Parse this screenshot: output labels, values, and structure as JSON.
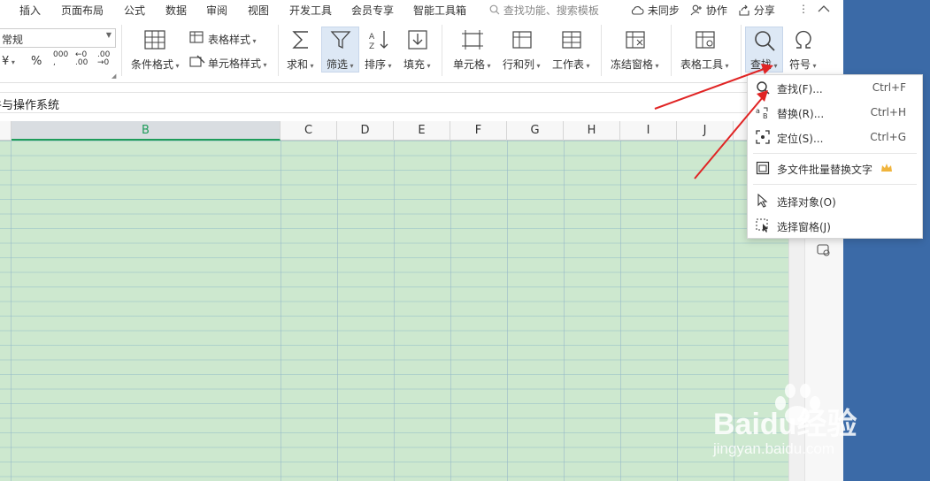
{
  "menu": {
    "items": [
      "插入",
      "页面布局",
      "公式",
      "数据",
      "审阅",
      "视图",
      "开发工具",
      "会员专享",
      "智能工具箱"
    ],
    "search_placeholder": "查找功能、搜索模板",
    "sync": "未同步",
    "collab": "协作",
    "share": "分享"
  },
  "ribbon": {
    "number_format": "常规",
    "currency": "¥",
    "percent": "%",
    "thousands": "000",
    "dec_inc": ".00",
    "dec_dec": ".00",
    "table_style": "表格样式",
    "cond_format": "条件格式",
    "cell_style": "单元格样式",
    "sum": "求和",
    "filter": "筛选",
    "sort": "排序",
    "fill": "填充",
    "cell": "单元格",
    "rowcol": "行和列",
    "worksheet": "工作表",
    "freeze": "冻结窗格",
    "table_tools": "表格工具",
    "find": "查找",
    "symbol": "符号"
  },
  "formula_bar": {
    "content": "牛与操作系统"
  },
  "columns": [
    "B",
    "C",
    "D",
    "E",
    "F",
    "G",
    "H",
    "I",
    "J"
  ],
  "selected_column": "B",
  "dropdown": {
    "items": [
      {
        "label": "查找(F)...",
        "shortcut": "Ctrl+F",
        "icon": "search-icon"
      },
      {
        "label": "替换(R)...",
        "shortcut": "Ctrl+H",
        "icon": "replace-icon"
      },
      {
        "label": "定位(S)...",
        "shortcut": "Ctrl+G",
        "icon": "locate-icon"
      },
      {
        "label": "多文件批量替换文字",
        "shortcut": "",
        "icon": "batch-replace-icon"
      },
      {
        "label": "选择对象(O)",
        "shortcut": "",
        "icon": "select-object-icon"
      },
      {
        "label": "选择窗格(J)",
        "shortcut": "",
        "icon": "select-pane-icon"
      }
    ]
  },
  "watermark": {
    "brand": "Baidu经验",
    "url": "jingyan.baidu.com"
  },
  "colors": {
    "grid_bg": "#cde8cf",
    "accent_green": "#1e9c5a",
    "arrow_red": "#e02424",
    "side_blue": "#3b6aa7"
  }
}
